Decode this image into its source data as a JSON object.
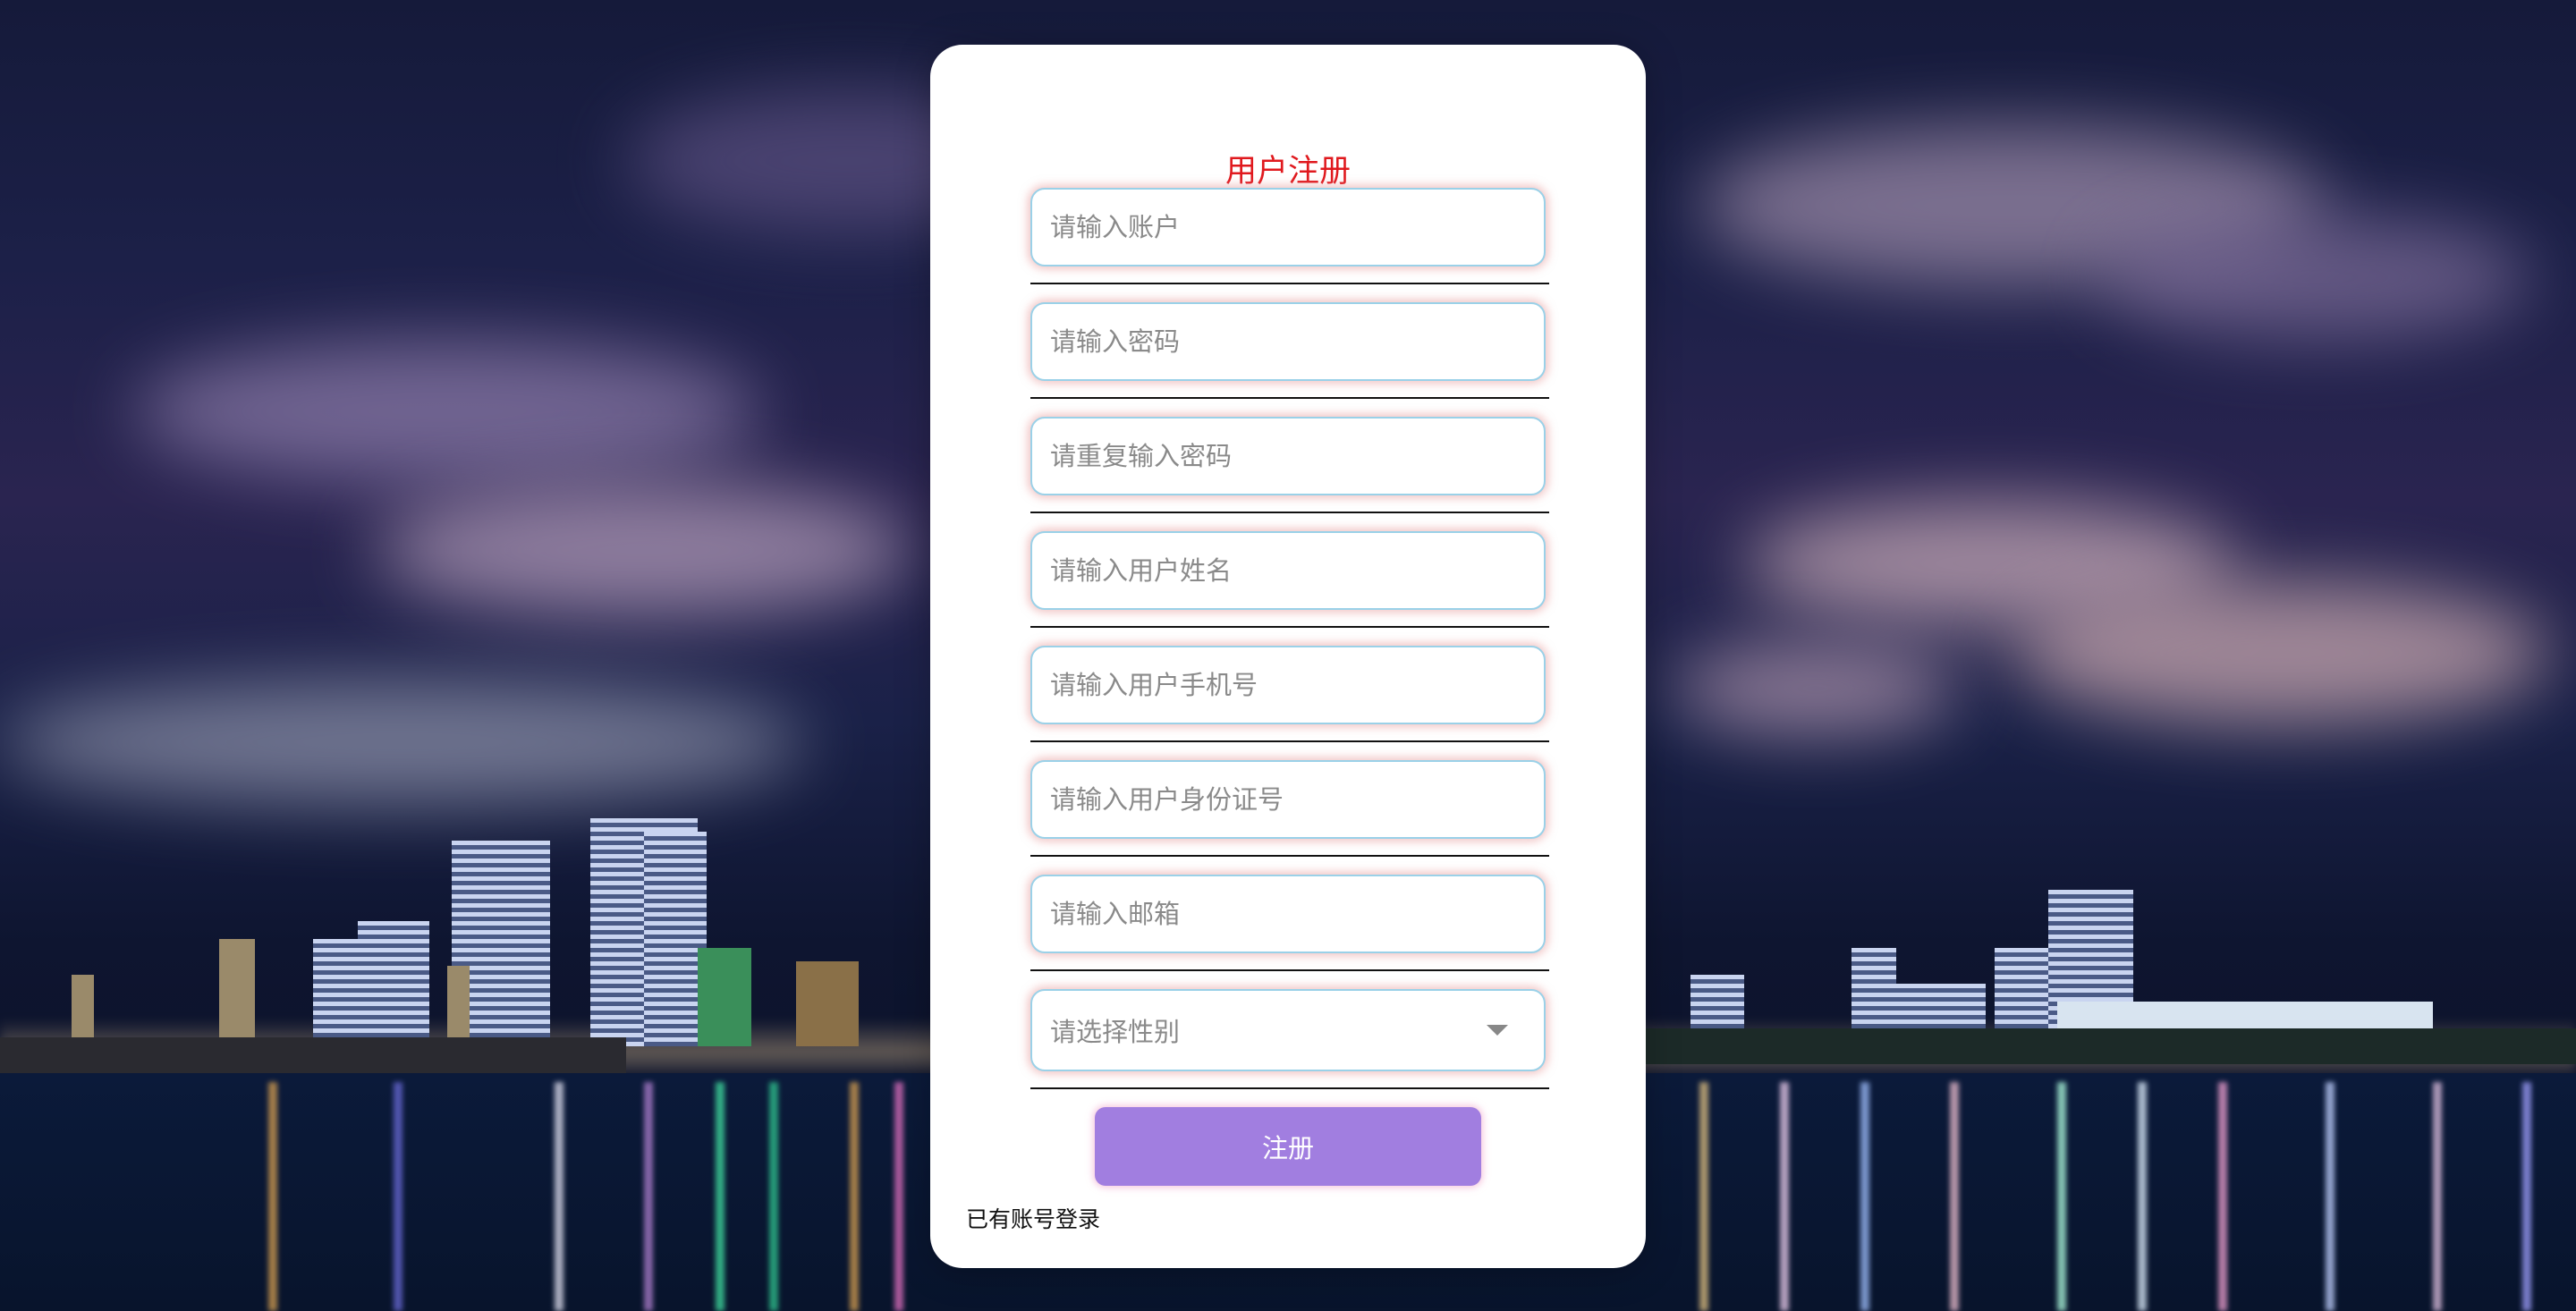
{
  "form": {
    "title": "用户注册",
    "fields": [
      {
        "placeholder": "请输入账户",
        "value": ""
      },
      {
        "placeholder": "请输入密码",
        "value": ""
      },
      {
        "placeholder": "请重复输入密码",
        "value": ""
      },
      {
        "placeholder": "请输入用户姓名",
        "value": ""
      },
      {
        "placeholder": "请输入用户手机号",
        "value": ""
      },
      {
        "placeholder": "请输入用户身份证号",
        "value": ""
      },
      {
        "placeholder": "请输入邮箱",
        "value": ""
      }
    ],
    "gender_select": {
      "placeholder": "请选择性别",
      "icon": "chevron-down-icon"
    },
    "submit_label": "注册",
    "login_link": "已有账号登录"
  },
  "colors": {
    "title": "#e0191e",
    "button": "#a17ee0",
    "card": "#ffffff",
    "field_border": "#9ad1e8"
  }
}
